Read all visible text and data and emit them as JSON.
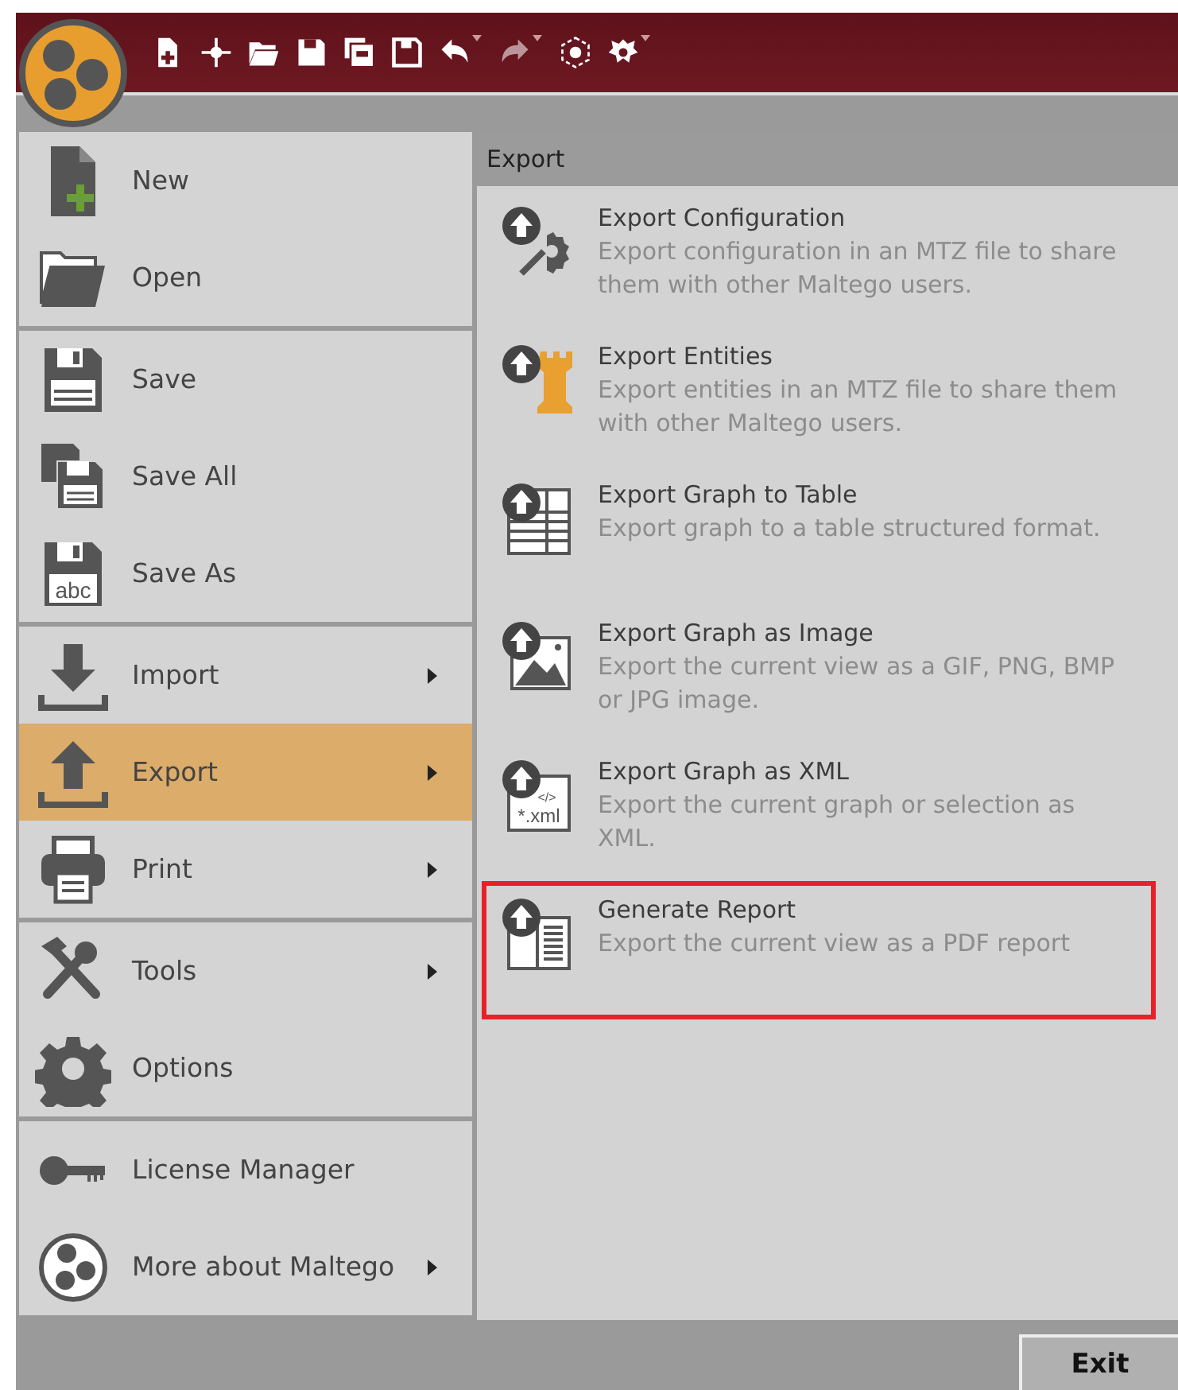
{
  "toolbar": [
    {
      "kind": "new",
      "disabled": false,
      "dropdown": false
    },
    {
      "kind": "node",
      "disabled": false,
      "dropdown": false
    },
    {
      "kind": "open",
      "disabled": false,
      "dropdown": false
    },
    {
      "kind": "save",
      "disabled": false,
      "dropdown": false
    },
    {
      "kind": "saveall",
      "disabled": false,
      "dropdown": false
    },
    {
      "kind": "saveas",
      "disabled": false,
      "dropdown": false
    },
    {
      "kind": "undo",
      "disabled": false,
      "dropdown": true
    },
    {
      "kind": "redo",
      "disabled": true,
      "dropdown": true
    },
    {
      "kind": "layout",
      "disabled": false,
      "dropdown": false
    },
    {
      "kind": "transform",
      "disabled": false,
      "dropdown": true
    }
  ],
  "menu": {
    "groups": [
      {
        "items": [
          {
            "kind": "new",
            "label": "New",
            "submenu": false,
            "selected": false
          },
          {
            "kind": "open",
            "label": "Open",
            "submenu": false,
            "selected": false
          }
        ]
      },
      {
        "items": [
          {
            "kind": "save",
            "label": "Save",
            "submenu": false,
            "selected": false
          },
          {
            "kind": "saveall",
            "label": "Save All",
            "submenu": false,
            "selected": false
          },
          {
            "kind": "saveas",
            "label": "Save As",
            "icon_text": "abc",
            "submenu": false,
            "selected": false
          }
        ]
      },
      {
        "items": [
          {
            "kind": "import",
            "label": "Import",
            "submenu": true,
            "selected": false
          },
          {
            "kind": "export",
            "label": "Export",
            "submenu": true,
            "selected": true
          },
          {
            "kind": "print",
            "label": "Print",
            "submenu": true,
            "selected": false
          }
        ]
      },
      {
        "items": [
          {
            "kind": "tools",
            "label": "Tools",
            "submenu": true,
            "selected": false
          },
          {
            "kind": "options",
            "label": "Options",
            "submenu": false,
            "selected": false
          }
        ]
      },
      {
        "items": [
          {
            "kind": "license",
            "label": "License Manager",
            "submenu": false,
            "selected": false
          },
          {
            "kind": "about",
            "label": "More about Maltego",
            "submenu": true,
            "selected": false
          }
        ]
      }
    ]
  },
  "submenu": {
    "title": "Export",
    "items": [
      {
        "kind": "config",
        "title": "Export Configuration",
        "description": "Export configuration in an MTZ file to share them with other Maltego users.",
        "highlighted": false
      },
      {
        "kind": "entities",
        "title": "Export Entities",
        "description": "Export entities in an MTZ file to share them with other Maltego users.",
        "highlighted": false
      },
      {
        "kind": "table",
        "title": "Export Graph to Table",
        "description": "Export graph to a table structured format.",
        "highlighted": false
      },
      {
        "kind": "image",
        "title": "Export Graph as Image",
        "description": "Export the current view as a GIF, PNG, BMP or JPG image.",
        "highlighted": false
      },
      {
        "kind": "xml",
        "title": "Export Graph as XML",
        "description": "Export the current graph or selection as XML.",
        "icon_text": [
          "</>",
          "*.xml"
        ],
        "highlighted": false
      },
      {
        "kind": "report",
        "title": "Generate Report",
        "description": "Export the current view as a PDF report",
        "highlighted": true
      }
    ]
  },
  "exit_button": "Exit"
}
